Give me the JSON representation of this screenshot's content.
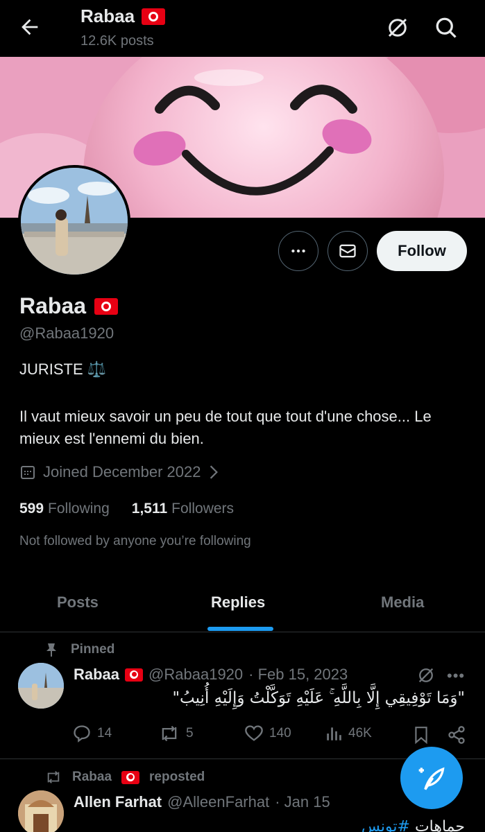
{
  "header": {
    "name": "Rabaa",
    "posts": "12.6K posts"
  },
  "profile": {
    "name": "Rabaa",
    "handle": "@Rabaa1920",
    "follow_label": "Follow",
    "bio_line1": "JURISTE ⚖️",
    "bio_line2": "Il vaut mieux savoir un peu de tout que tout d'une chose... Le mieux est l'ennemi du bien.",
    "joined": "Joined December 2022",
    "following_count": "599",
    "following_label": "Following",
    "followers_count": "1,511",
    "followers_label": "Followers",
    "not_followed": "Not followed by anyone you’re following"
  },
  "tabs": [
    {
      "label": "Posts"
    },
    {
      "label": "Replies"
    },
    {
      "label": "Media"
    }
  ],
  "pinned_tweet": {
    "pinned_label": "Pinned",
    "name": "Rabaa",
    "handle": "@Rabaa1920",
    "date": "· Feb 15, 2023",
    "text": "\"وَمَا تَوْفِيقِي إِلَّا بِاللَّهِ ۚ عَلَيْهِ تَوَكَّلْتُ وَإِلَيْهِ أُنِيبُ\"",
    "replies": "14",
    "reposts": "5",
    "likes": "140",
    "views": "46K"
  },
  "repost_tweet": {
    "reposted_by": "Rabaa",
    "reposted_label": "reposted",
    "name": "Allen Farhat",
    "handle": "@AlleenFarhat",
    "date": "· Jan 15",
    "text_plain": "جماهات ",
    "text_hashtag": "#تونس"
  },
  "colors": {
    "accent": "#1d9bf0",
    "flag_red": "#e70013",
    "muted": "#71767b",
    "text": "#e7e9ea"
  }
}
